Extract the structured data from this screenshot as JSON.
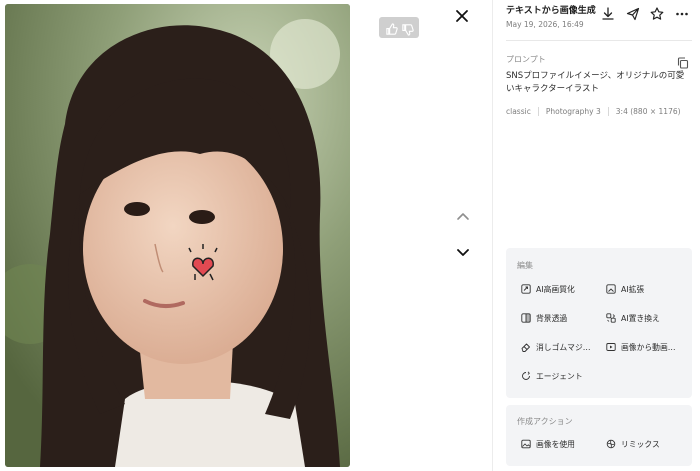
{
  "panel": {
    "title": "テキストから画像生成",
    "date": "May 19, 2026, 16:49",
    "prompt_label": "プロンプト",
    "prompt_text": "SNSプロファイルイメージ、オリジナルの可愛いキャラクターイラスト",
    "meta": {
      "style": "classic",
      "model": "Photography 3",
      "ratio": "3:4 (880 × 1176)"
    },
    "edit_section": {
      "title": "編集",
      "actions": [
        {
          "label": "AI高画質化",
          "icon": "upscale-icon"
        },
        {
          "label": "AI拡張",
          "icon": "expand-icon"
        },
        {
          "label": "背景透過",
          "icon": "background-remove-icon"
        },
        {
          "label": "AI置き換え",
          "icon": "replace-icon"
        },
        {
          "label": "消しゴムマジ…",
          "icon": "eraser-icon"
        },
        {
          "label": "画像から動画…",
          "icon": "video-icon"
        },
        {
          "label": "エージェント",
          "icon": "agent-icon"
        }
      ]
    },
    "create_section": {
      "title": "作成アクション",
      "actions": [
        {
          "label": "画像を使用",
          "icon": "image-icon"
        },
        {
          "label": "リミックス",
          "icon": "remix-icon"
        }
      ]
    },
    "toolbar_icons": [
      "download-icon",
      "share-icon",
      "star-icon",
      "more-icon"
    ]
  },
  "viewer": {
    "image_subject": "portrait photo",
    "icons": [
      "thumbs-up-icon",
      "thumbs-down-icon",
      "close-icon",
      "chevron-up-icon",
      "chevron-down-icon"
    ]
  },
  "colors": {
    "card_bg": "#f3f4f6",
    "muted_text": "#7d7d7d",
    "feedback_bg": "#cfcfcf"
  }
}
